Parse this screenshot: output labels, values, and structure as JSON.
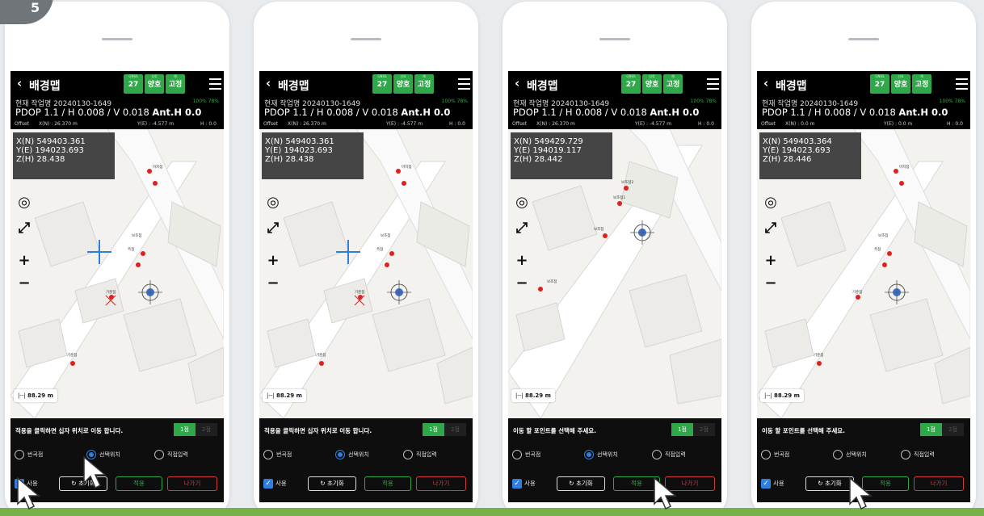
{
  "step_number": "5",
  "colors": {
    "accent_green": "#2fa84a",
    "bar_green": "#78b04a",
    "select_blue": "#2f7fe0",
    "exit_red": "#d23b3b"
  },
  "app": {
    "back_icon": "chevron-left-icon",
    "title": "배경맵",
    "status_chips": [
      {
        "top": "GNSS",
        "value": "27"
      },
      {
        "top": "신호",
        "value": "양호"
      },
      {
        "top": "해",
        "value": "고정"
      }
    ],
    "job_line": "현재 작업명 20240130-1649",
    "battery_text": "100%  78%",
    "pdop_line": "PDOP 1.1 / H 0.008 / V 0.018",
    "ant_h": "Ant.H 0.0",
    "scale_text": "88.29 m",
    "scale_prefix": "|--|",
    "radios": {
      "first": "번곡점",
      "second": "선택위치",
      "third": "직접입력"
    },
    "use_label": "사용",
    "reset_label": "초기화",
    "apply_label": "적용",
    "exit_label": "나가기",
    "step_one": "1점",
    "step_two": "2점"
  },
  "screens": [
    {
      "offset_label": "Offset",
      "offset_x": "X(N) : 26.370 m",
      "offset_y": "Y(E) : -4.577 m",
      "offset_h": "H : 0.0",
      "coord_x": "X(N) 549403.361",
      "coord_y": "Y(E) 194023.693",
      "coord_z": "Z(H) 28.438",
      "message": "적용을 클릭하면 십자 위치로 이동 합니다.",
      "selected_radio": "second"
    },
    {
      "offset_label": "Offset",
      "offset_x": "X(N) : 26.370 m",
      "offset_y": "Y(E) : -4.577 m",
      "offset_h": "H : 0.0",
      "coord_x": "X(N) 549403.361",
      "coord_y": "Y(E) 194023.693",
      "coord_z": "Z(H) 28.438",
      "message": "적용을 클릭하면 십자 위치로 이동 합니다.",
      "selected_radio": "second"
    },
    {
      "offset_label": "Offset",
      "offset_x": "X(N) : 26.370 m",
      "offset_y": "Y(E) : -4.577 m",
      "offset_h": "H : 0.0",
      "coord_x": "X(N) 549429.729",
      "coord_y": "Y(E) 194019.117",
      "coord_z": "Z(H) 28.442",
      "message": "이동 할 포인트를 선택해 주세요.",
      "selected_radio": "second"
    },
    {
      "offset_label": "Offset",
      "offset_x": "X(N) : 0.0 m",
      "offset_y": "Y(E) : 0.0 m",
      "offset_h": "H : 0.0",
      "coord_x": "X(N) 549403.364",
      "coord_y": "Y(E) 194023.693",
      "coord_z": "Z(H) 28.446",
      "message": "이동 할 포인트를 선택해 주세요.",
      "selected_radio": "none"
    }
  ]
}
